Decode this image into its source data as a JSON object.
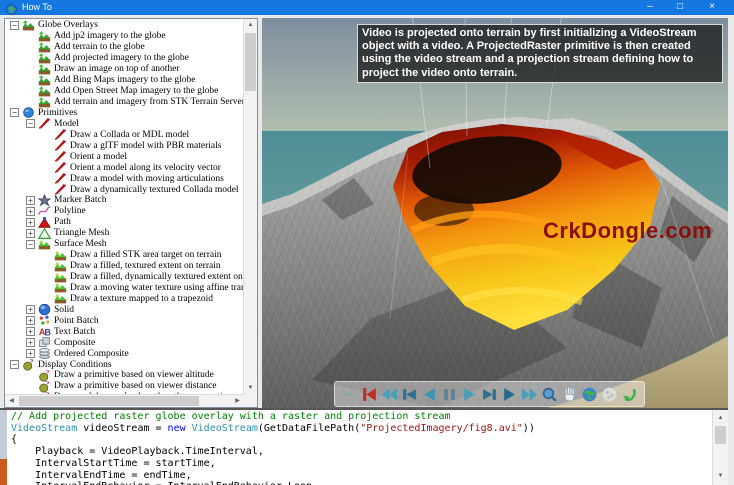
{
  "window": {
    "title": "How To",
    "controls": {
      "minimize": "–",
      "maximize": "□",
      "close": "×"
    }
  },
  "scrollbars": {
    "up": "▲",
    "down": "▼",
    "left": "◀",
    "right": "▶"
  },
  "tree": {
    "items": [
      {
        "label": "Globe Overlays",
        "level": 0,
        "expander": "minus",
        "icon": "terrain-overlay-icon"
      },
      {
        "label": "Add jp2 imagery to the globe",
        "level": 1,
        "expander": "none",
        "icon": "terrain-overlay-icon"
      },
      {
        "label": "Add terrain to the globe",
        "level": 1,
        "expander": "none",
        "icon": "terrain-overlay-icon"
      },
      {
        "label": "Add projected imagery to the globe",
        "level": 1,
        "expander": "none",
        "icon": "terrain-overlay-icon"
      },
      {
        "label": "Draw an image on top of another",
        "level": 1,
        "expander": "none",
        "icon": "terrain-overlay-icon"
      },
      {
        "label": "Add Bing Maps imagery to the globe",
        "level": 1,
        "expander": "none",
        "icon": "terrain-overlay-icon"
      },
      {
        "label": "Add Open Street Map imagery to the globe",
        "level": 1,
        "expander": "none",
        "icon": "terrain-overlay-icon"
      },
      {
        "label": "Add terrain and imagery from STK Terrain Server o",
        "level": 1,
        "expander": "none",
        "icon": "terrain-overlay-icon"
      },
      {
        "label": "Primitives",
        "level": 0,
        "expander": "minus",
        "icon": "primitives-icon"
      },
      {
        "label": "Model",
        "level": 1,
        "expander": "minus",
        "icon": "model-icon"
      },
      {
        "label": "Draw a Collada or MDL model",
        "level": 2,
        "expander": "none",
        "icon": "model-icon"
      },
      {
        "label": "Draw a glTF model with PBR materials",
        "level": 2,
        "expander": "none",
        "icon": "model-icon"
      },
      {
        "label": "Orient a model",
        "level": 2,
        "expander": "none",
        "icon": "model-icon"
      },
      {
        "label": "Orient a model along its velocity vector",
        "level": 2,
        "expander": "none",
        "icon": "model-icon"
      },
      {
        "label": "Draw a model with moving articulations",
        "level": 2,
        "expander": "none",
        "icon": "model-icon"
      },
      {
        "label": "Draw a dynamically textured Collada model",
        "level": 2,
        "expander": "none",
        "icon": "model-icon"
      },
      {
        "label": "Marker Batch",
        "level": 1,
        "expander": "plus",
        "icon": "marker-batch-icon"
      },
      {
        "label": "Polyline",
        "level": 1,
        "expander": "plus",
        "icon": "polyline-icon"
      },
      {
        "label": "Path",
        "level": 1,
        "expander": "plus",
        "icon": "path-icon"
      },
      {
        "label": "Triangle Mesh",
        "level": 1,
        "expander": "plus",
        "icon": "triangle-mesh-icon"
      },
      {
        "label": "Surface Mesh",
        "level": 1,
        "expander": "minus",
        "icon": "surface-mesh-icon"
      },
      {
        "label": "Draw a filled STK area target on terrain",
        "level": 2,
        "expander": "none",
        "icon": "surface-mesh-icon"
      },
      {
        "label": "Draw a filled, textured extent on terrain",
        "level": 2,
        "expander": "none",
        "icon": "surface-mesh-icon"
      },
      {
        "label": "Draw a filled, dynamically textured extent on",
        "level": 2,
        "expander": "none",
        "icon": "surface-mesh-icon"
      },
      {
        "label": "Draw a moving water texture using affine trans",
        "level": 2,
        "expander": "none",
        "icon": "surface-mesh-icon"
      },
      {
        "label": "Draw a texture mapped to a trapezoid",
        "level": 2,
        "expander": "none",
        "icon": "surface-mesh-icon"
      },
      {
        "label": "Solid",
        "level": 1,
        "expander": "plus",
        "icon": "solid-icon"
      },
      {
        "label": "Point Batch",
        "level": 1,
        "expander": "plus",
        "icon": "point-batch-icon"
      },
      {
        "label": "Text Batch",
        "level": 1,
        "expander": "plus",
        "icon": "text-batch-icon"
      },
      {
        "label": "Composite",
        "level": 1,
        "expander": "plus",
        "icon": "composite-icon"
      },
      {
        "label": "Ordered Composite",
        "level": 1,
        "expander": "plus",
        "icon": "ordered-composite-icon"
      },
      {
        "label": "Display Conditions",
        "level": 0,
        "expander": "minus",
        "icon": "display-conditions-icon"
      },
      {
        "label": "Draw a primitive based on viewer altitude",
        "level": 1,
        "expander": "none",
        "icon": "display-conditions-icon"
      },
      {
        "label": "Draw a primitive based on viewer distance",
        "level": 1,
        "expander": "none",
        "icon": "display-conditions-icon"
      },
      {
        "label": "Draw a globe overlay based on the current time",
        "level": 1,
        "expander": "none",
        "icon": "display-conditions-icon"
      }
    ]
  },
  "viewport": {
    "info_text": "Video is projected onto terrain by first initializing a VideoStream object with a video. A ProjectedRaster primitive is then created using the video stream and a projection stream defining how to project the video onto terrain.",
    "watermark": "CrkDongle.com",
    "watermark_color": "#8b0e0e",
    "toolbar": {
      "buttons": [
        {
          "name": "collapse-toolbar-button",
          "icon": "minus-icon"
        },
        {
          "name": "skip-to-start-button",
          "icon": "skip-start-icon"
        },
        {
          "name": "rewind-button",
          "icon": "rewind-icon"
        },
        {
          "name": "step-backward-button",
          "icon": "step-back-icon"
        },
        {
          "name": "play-backward-button",
          "icon": "play-back-icon"
        },
        {
          "name": "pause-button",
          "icon": "pause-icon"
        },
        {
          "name": "play-button",
          "icon": "play-icon"
        },
        {
          "name": "step-forward-button",
          "icon": "step-forward-icon"
        },
        {
          "name": "play-faster-button",
          "icon": "play-dark-icon"
        },
        {
          "name": "fast-forward-button",
          "icon": "fast-forward-icon"
        },
        {
          "name": "zoom-tool-button",
          "icon": "magnifier-icon"
        },
        {
          "name": "pan-tool-button",
          "icon": "hand-icon"
        },
        {
          "name": "earth-view-button",
          "icon": "globe-icon"
        },
        {
          "name": "moon-view-button",
          "icon": "moon-icon"
        },
        {
          "name": "reset-view-button",
          "icon": "green-arrow-icon"
        }
      ]
    }
  },
  "code": {
    "lines": [
      {
        "seg": [
          {
            "c": "com",
            "t": "// Add projected raster globe overlay with a raster and projection stream"
          }
        ]
      },
      {
        "seg": [
          {
            "c": "typ",
            "t": "VideoStream"
          },
          {
            "c": "pln",
            "t": " videoStream = "
          },
          {
            "c": "kw",
            "t": "new "
          },
          {
            "c": "typ",
            "t": "VideoStream"
          },
          {
            "c": "pln",
            "t": "(GetDataFilePath("
          },
          {
            "c": "str",
            "t": "\"ProjectedImagery/fig8.avi\""
          },
          {
            "c": "pln",
            "t": "))"
          }
        ]
      },
      {
        "seg": [
          {
            "c": "pln",
            "t": "{"
          }
        ]
      },
      {
        "seg": [
          {
            "c": "pln",
            "t": "    Playback = VideoPlayback.TimeInterval,"
          }
        ]
      },
      {
        "seg": [
          {
            "c": "pln",
            "t": "    IntervalStartTime = startTime,"
          }
        ]
      },
      {
        "seg": [
          {
            "c": "pln",
            "t": "    IntervalEndTime = endTime,"
          }
        ]
      },
      {
        "seg": [
          {
            "c": "pln",
            "t": "    IntervalEndBehavior = IntervalEndBehavior.Loop"
          }
        ]
      }
    ]
  }
}
